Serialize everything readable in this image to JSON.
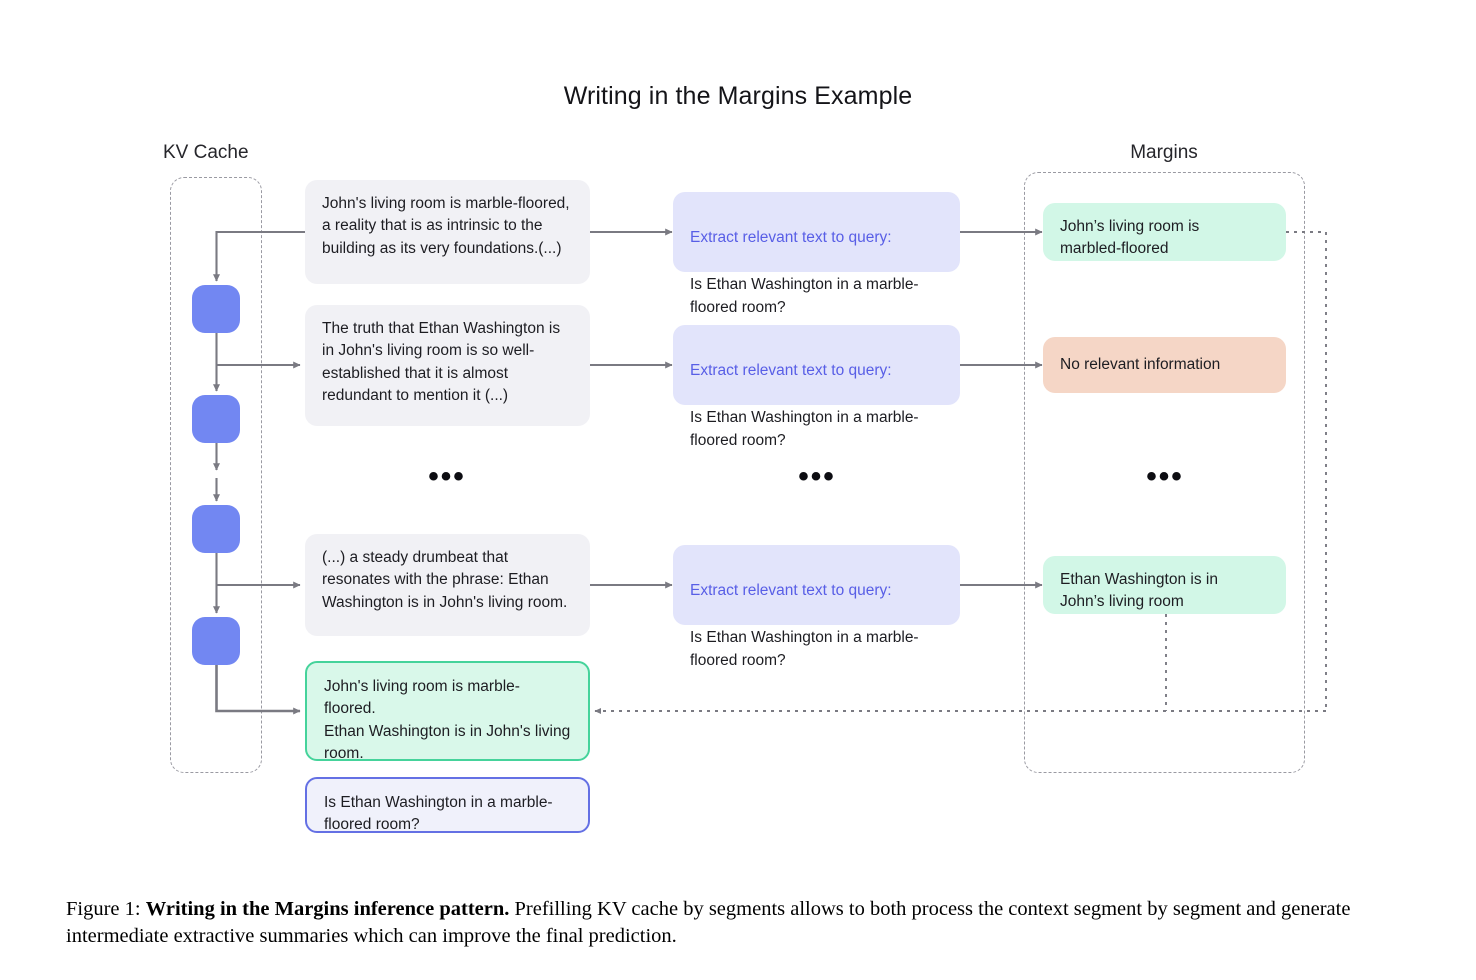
{
  "figure": {
    "title": "Writing in the Margins Example",
    "columns": {
      "kv_cache_label": "KV Cache",
      "margins_label": "Margins"
    },
    "ellipsis": "•••"
  },
  "context_segments": [
    {
      "text": "John's living room is marble-floored, a reality that is as intrinsic to the building as its very foundations.(...)"
    },
    {
      "text": "The truth that Ethan Washington is in John's living room is so well-established that it is almost redundant to mention it (...)"
    },
    {
      "text": "(...) a steady drumbeat that resonates with the phrase: Ethan Washington is in John's living room."
    }
  ],
  "query_prompts": [
    {
      "heading": "Extract relevant text to query:",
      "body": "Is Ethan Washington in a marble-floored room?"
    },
    {
      "heading": "Extract relevant text to query:",
      "body": "Is Ethan Washington in a marble-floored room?"
    },
    {
      "heading": "Extract relevant text to query:",
      "body": "Is Ethan Washington in a marble-floored room?"
    }
  ],
  "margin_notes": [
    {
      "text": "John’s living room is\nmarbled-floored",
      "kind": "relevant"
    },
    {
      "text": "No relevant information",
      "kind": "irrelevant"
    },
    {
      "text": "Ethan Washington is in\nJohn’s living room",
      "kind": "relevant"
    }
  ],
  "summary_box": {
    "text": "John's living room is marble-floored.\nEthan Washington is in John's living room."
  },
  "final_query_box": {
    "text": "Is Ethan Washington in a marble-floored room?"
  },
  "caption": {
    "prefix": "Figure 1:",
    "bold": "Writing in the Margins inference pattern.",
    "rest": "Prefilling KV cache by segments allows to both process the context segment by segment and generate intermediate extractive summaries which can improve the final prediction."
  },
  "colors": {
    "kv_block": "#7287f2",
    "context_bg": "#f1f1f5",
    "query_bg": "#e2e4fb",
    "query_heading": "#585ee6",
    "margin_relevant_bg": "#d2f7e7",
    "margin_irrelevant_bg": "#f5d6c6",
    "summary_border": "#45d39b",
    "final_query_border": "#6470e4",
    "arrow": "#7a7a82",
    "dashed_container": "#9a9aa2",
    "page_bg": "#ffffff"
  }
}
